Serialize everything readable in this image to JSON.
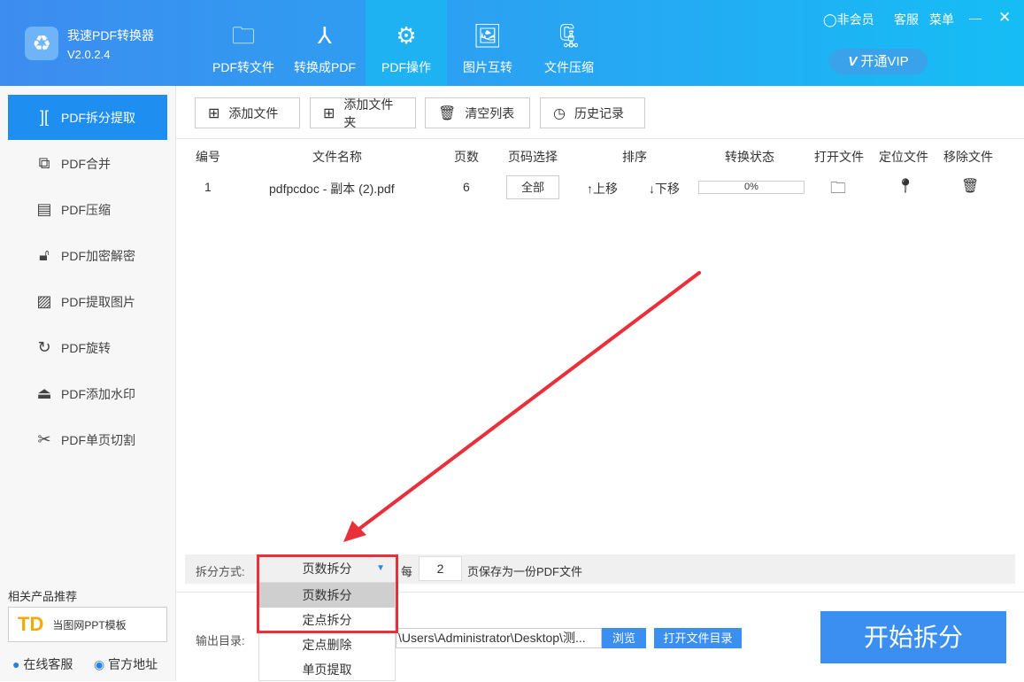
{
  "app": {
    "name": "我速PDF转换器",
    "version": "V2.0.2.4"
  },
  "nav": [
    {
      "label": "PDF转文件",
      "icon": "folder-icon"
    },
    {
      "label": "转换成PDF",
      "icon": "acrobat-icon"
    },
    {
      "label": "PDF操作",
      "icon": "gear-icon"
    },
    {
      "label": "图片互转",
      "icon": "image-icon"
    },
    {
      "label": "文件压缩",
      "icon": "zip-icon"
    }
  ],
  "top": {
    "member": "非会员",
    "service": "客服",
    "menu": "菜单",
    "vip": "开通VIP"
  },
  "sidebar": {
    "items": [
      {
        "label": "PDF拆分提取"
      },
      {
        "label": "PDF合并"
      },
      {
        "label": "PDF压缩"
      },
      {
        "label": "PDF加密解密"
      },
      {
        "label": "PDF提取图片"
      },
      {
        "label": "PDF旋转"
      },
      {
        "label": "PDF添加水印"
      },
      {
        "label": "PDF单页切割"
      }
    ],
    "recommend_title": "相关产品推荐",
    "recommend_item": "当图网PPT模板",
    "online_service": "在线客服",
    "official_site": "官方地址"
  },
  "toolbar": {
    "add_file": "添加文件",
    "add_folder": "添加文件夹",
    "clear": "清空列表",
    "history": "历史记录"
  },
  "table": {
    "headers": [
      "编号",
      "文件名称",
      "页数",
      "页码选择",
      "排序",
      "转换状态",
      "打开文件",
      "定位文件",
      "移除文件"
    ],
    "rows": [
      {
        "no": "1",
        "name": "pdfpcdoc - 副本 (2).pdf",
        "pages": "6",
        "page_select": "全部",
        "up": "↑上移",
        "down": "↓下移",
        "progress": "0%"
      }
    ]
  },
  "split": {
    "label": "拆分方式:",
    "selected": "页数拆分",
    "every": "每",
    "count": "2",
    "suffix": "页保存为一份PDF文件",
    "options": [
      "页数拆分",
      "定点拆分",
      "定点删除",
      "单页提取"
    ]
  },
  "output": {
    "label": "输出目录:",
    "path": "\\Users\\Administrator\\Desktop\\测...",
    "browse": "浏览",
    "open_dir": "打开文件目录"
  },
  "start": "开始拆分"
}
